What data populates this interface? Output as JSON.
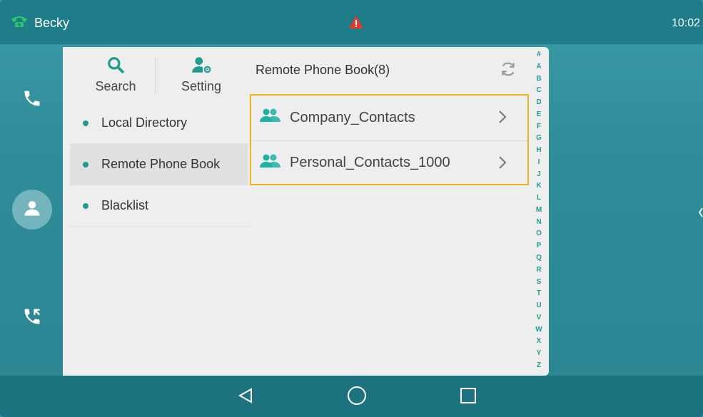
{
  "status_bar": {
    "user": "Becky",
    "time": "10:02"
  },
  "menu": {
    "search_label": "Search",
    "setting_label": "Setting",
    "items": [
      {
        "label": "Local Directory"
      },
      {
        "label": "Remote Phone Book"
      },
      {
        "label": "Blacklist"
      }
    ]
  },
  "content": {
    "title": "Remote Phone Book(8)",
    "groups": [
      {
        "name": "Company_Contacts"
      },
      {
        "name": "Personal_Contacts_1000"
      }
    ]
  },
  "alphabet": [
    "#",
    "A",
    "B",
    "C",
    "D",
    "E",
    "F",
    "G",
    "H",
    "I",
    "J",
    "K",
    "L",
    "M",
    "N",
    "O",
    "P",
    "Q",
    "R",
    "S",
    "T",
    "U",
    "V",
    "W",
    "X",
    "Y",
    "Z"
  ],
  "colors": {
    "accent": "#1f9c8f",
    "highlight": "#f0b21b",
    "background": "#2f8f9c"
  }
}
